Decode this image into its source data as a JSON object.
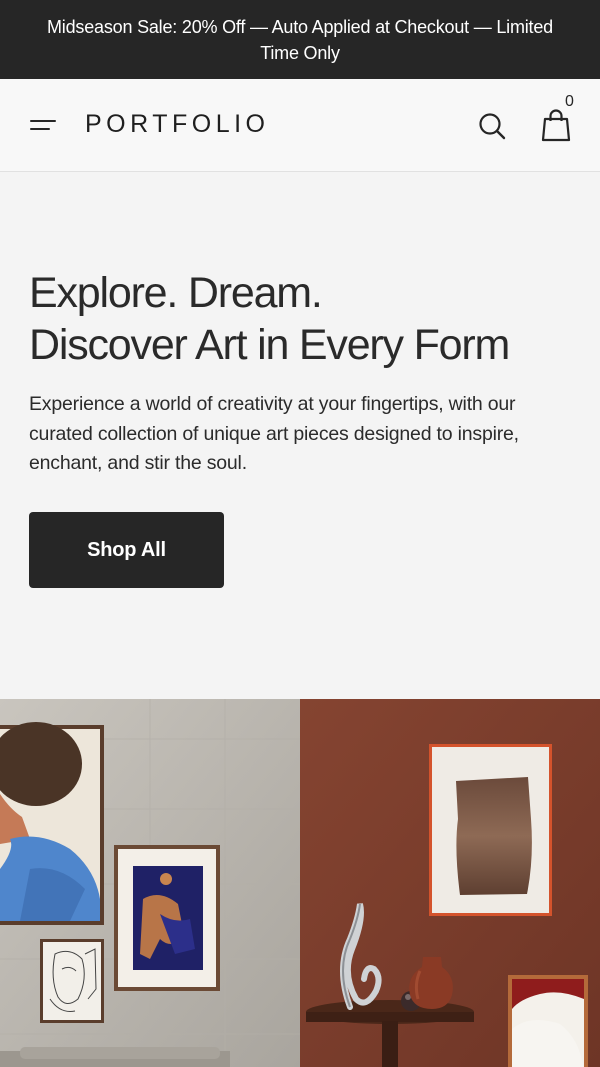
{
  "announcement": {
    "text": "Midseason Sale: 20% Off — Auto Applied at Checkout — Limited Time Only"
  },
  "header": {
    "logo": "PORTFOLIO",
    "menu_icon": "hamburger-icon",
    "search_icon": "search-icon",
    "cart_icon": "shopping-bag-icon",
    "cart_count": "0"
  },
  "hero": {
    "title_line1": "Explore. Dream.",
    "title_line2": "Discover Art in Every Form",
    "description": "Experience a world of creativity at your fingertips, with our curated collection of unique art pieces designed to inspire, enchant, and stir the soul.",
    "cta_label": "Shop All"
  },
  "colors": {
    "announcement_bg": "#262626",
    "header_bg": "#f8f8f8",
    "hero_bg": "#f4f4f4",
    "button_bg": "#262626",
    "wall_concrete": "#bdb9b2",
    "wall_terracotta": "#7b3d2b"
  }
}
